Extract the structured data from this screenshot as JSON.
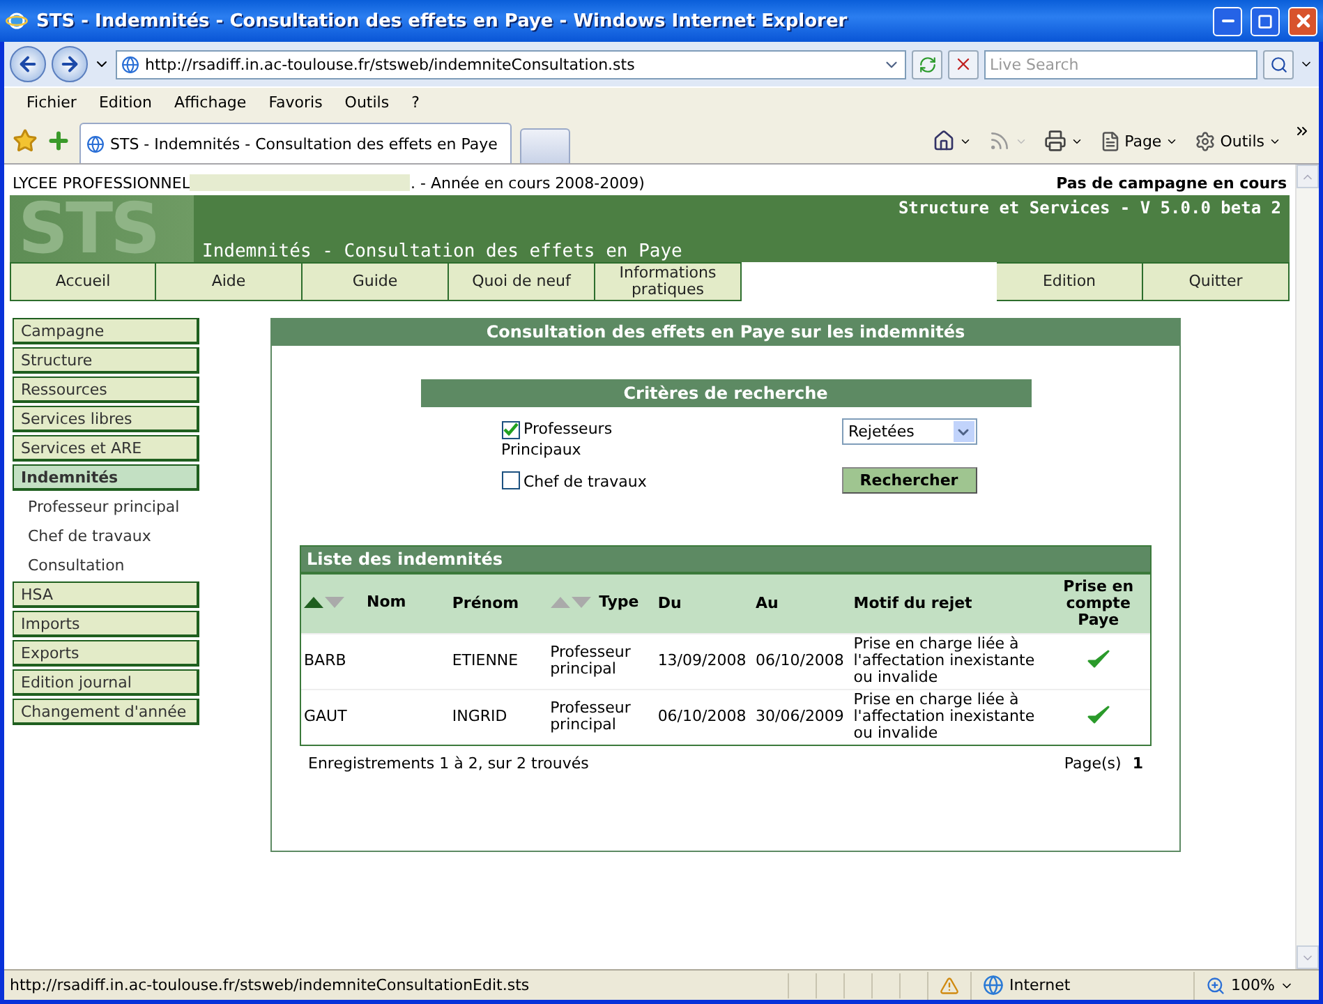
{
  "browser": {
    "title": "STS - Indemnités - Consultation des effets en Paye - Windows Internet Explorer",
    "address": "http://rsadiff.in.ac-toulouse.fr/stsweb/indemniteConsultation.sts",
    "search_placeholder": "Live Search",
    "menu": [
      "Fichier",
      "Edition",
      "Affichage",
      "Favoris",
      "Outils",
      "?"
    ],
    "tab_title": "STS - Indemnités - Consultation des effets en Paye",
    "tools": [
      {
        "kind": "page",
        "label": "Page"
      },
      {
        "kind": "tools",
        "label": "Outils"
      }
    ],
    "status_url": "http://rsadiff.in.ac-toulouse.fr/stsweb/indemniteConsultationEdit.sts",
    "zone": "Internet",
    "zoom": "100%"
  },
  "page": {
    "school": "LYCEE PROFESSIONNEL",
    "school_suffix": ". - Année en cours 2008-2009)",
    "campaign": "Pas de campagne en cours",
    "logo": "STS",
    "version": "Structure et Services - V 5.0.0 beta 2",
    "title": "Indemnités - Consultation des effets en Paye",
    "nav_left": [
      "Accueil",
      "Aide",
      "Guide",
      "Quoi de neuf",
      "Informations pratiques"
    ],
    "nav_right": [
      "Edition",
      "Quitter"
    ],
    "sidebar": [
      {
        "label": "Campagne",
        "selected": false
      },
      {
        "label": "Structure",
        "selected": false
      },
      {
        "label": "Ressources",
        "selected": false
      },
      {
        "label": "Services libres",
        "selected": false
      },
      {
        "label": "Services et ARE",
        "selected": false
      },
      {
        "label": "Indemnités",
        "selected": true,
        "children": [
          {
            "label": "Professeur principal"
          },
          {
            "label": "Chef de travaux"
          },
          {
            "label": "Consultation"
          }
        ]
      },
      {
        "label": "HSA",
        "selected": false
      },
      {
        "label": "Imports",
        "selected": false
      },
      {
        "label": "Exports",
        "selected": false
      },
      {
        "label": "Edition journal",
        "selected": false
      },
      {
        "label": "Changement d'année",
        "selected": false
      }
    ],
    "panel_title": "Consultation des effets en Paye sur les indemnités",
    "criteria": {
      "title": "Critères de recherche",
      "checkboxes": [
        {
          "label": "Professeurs Principaux",
          "checked": true
        },
        {
          "label": "Chef de travaux",
          "checked": false
        }
      ],
      "select": "Rejetées",
      "button": "Rechercher"
    },
    "list": {
      "title": "Liste des indemnités",
      "columns": [
        {
          "label": "Nom",
          "sortable": true,
          "sorted_ascending": true
        },
        {
          "label": "Prénom"
        },
        {
          "label": "Type",
          "sortable": true,
          "sorted_ascending": false
        },
        {
          "label": "Du"
        },
        {
          "label": "Au"
        },
        {
          "label": "Motif du rejet"
        },
        {
          "label": "Prise en compte Paye"
        }
      ],
      "rows": [
        {
          "nom": "BARB",
          "prenom": "ETIENNE",
          "type": "Professeur principal",
          "du": "13/09/2008",
          "au": "06/10/2008",
          "motif": "Prise en charge liée à l'affectation inexistante ou invalide",
          "in_pay": true
        },
        {
          "nom": "GAUT",
          "prenom": "INGRID",
          "type": "Professeur principal",
          "du": "06/10/2008",
          "au": "30/06/2009",
          "motif": "Prise en charge liée à l'affectation inexistante ou invalide",
          "in_pay": true
        }
      ],
      "summary": "Enregistrements 1 à 2, sur 2 trouvés",
      "pages_label": "Page(s)",
      "page": "1"
    }
  }
}
